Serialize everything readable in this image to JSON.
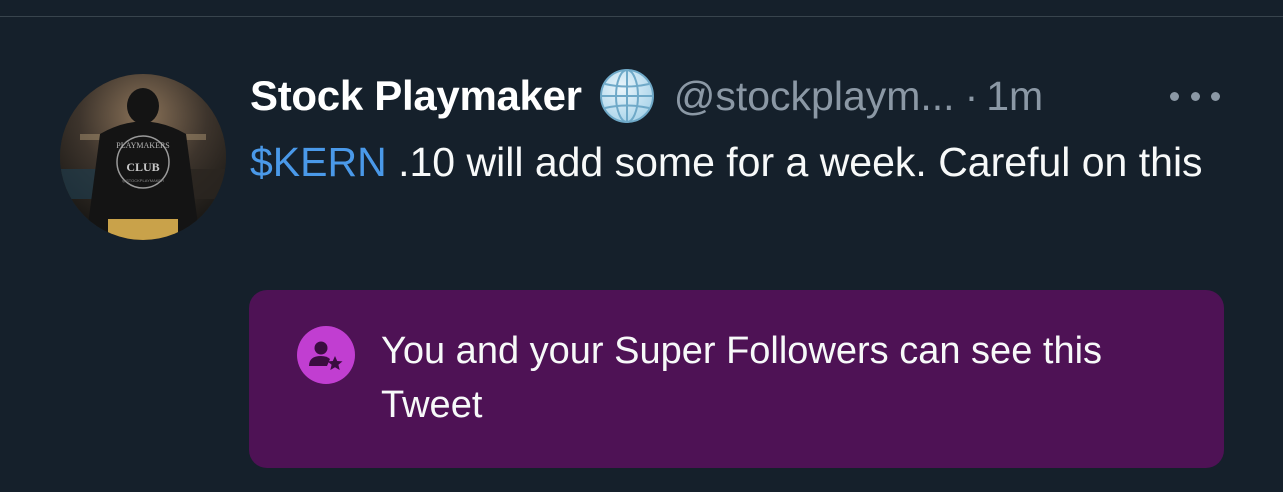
{
  "tweet": {
    "author_name": "Stock Playmaker",
    "author_handle": "@stockplaym...",
    "separator": "·",
    "timestamp": "1m",
    "verified_icon": "globe-icon",
    "more_icon": "more-horizontal-icon",
    "avatar": {
      "logo_text_top": "PLAYMAKERS",
      "logo_text_bottom": "CLUB",
      "logo_text_small": "@STOCKPLAYMAKER"
    },
    "text_cashtag": "$KERN",
    "text_body": " .10 will add some for a week. Careful on this"
  },
  "notice": {
    "icon": "super-follower-icon",
    "text": "You and your Super Followers can see this Tweet"
  },
  "colors": {
    "background": "#15202b",
    "cashtag": "#4a99e9",
    "notice_background": "#4e1255",
    "notice_icon": "#c13ed1",
    "muted_text": "#8b98a5"
  }
}
